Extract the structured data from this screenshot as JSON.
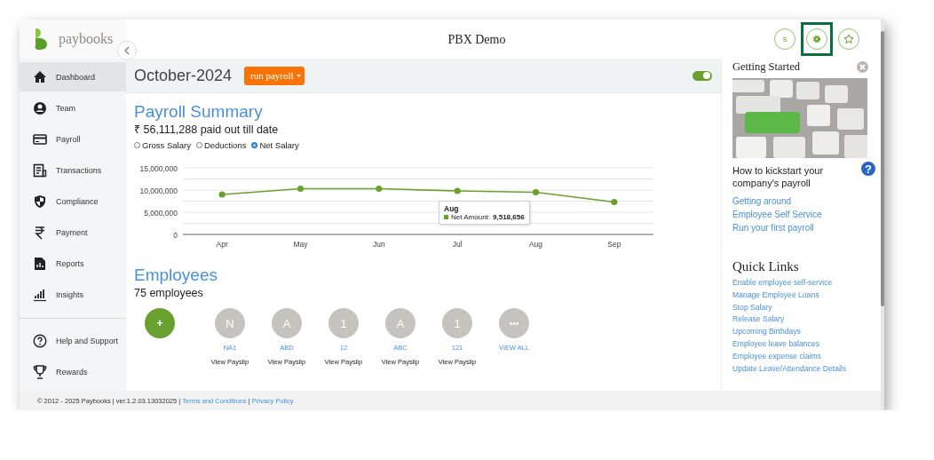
{
  "header": {
    "logo_text": "paybooks",
    "title": "PBX Demo",
    "user_initial": "s",
    "settings_highlighted": true
  },
  "sidebar": {
    "items": [
      {
        "label": "Dashboard",
        "selected": true
      },
      {
        "label": "Team",
        "selected": false
      },
      {
        "label": "Payroll",
        "selected": false
      },
      {
        "label": "Transactions",
        "selected": false
      },
      {
        "label": "Compliance",
        "selected": false
      },
      {
        "label": "Payment",
        "selected": false
      },
      {
        "label": "Reports",
        "selected": false
      },
      {
        "label": "Insights",
        "selected": false
      }
    ],
    "bottom_items": [
      {
        "label": "Help and Support",
        "selected": false
      },
      {
        "label": "Rewards",
        "selected": false
      }
    ]
  },
  "toolbar": {
    "period": "October-2024",
    "run_button": "run payroll",
    "toggle_on": true
  },
  "payroll_summary": {
    "title": "Payroll Summary",
    "total": "₹ 56,111,288 paid out till date",
    "options": [
      {
        "label": "Gross Salary",
        "selected": false
      },
      {
        "label": "Deductions",
        "selected": false
      },
      {
        "label": "Net Salary",
        "selected": true
      }
    ],
    "chart_data": {
      "type": "line",
      "categories": [
        "Apr",
        "May",
        "Jun",
        "Jul",
        "Aug",
        "Sep"
      ],
      "series": [
        {
          "name": "Net Amount",
          "color": "#6aa12e",
          "marker": "circle",
          "values": [
            9000000,
            10300000,
            10300000,
            9800000,
            9500000,
            7300000
          ]
        }
      ],
      "ylim": [
        0,
        15000000
      ],
      "yticks": [
        {
          "value": 0,
          "label": "0"
        },
        {
          "value": 5000000,
          "label": "5,000,000"
        },
        {
          "value": 10000000,
          "label": "10,000,000"
        },
        {
          "value": 15000000,
          "label": "15,000,000"
        }
      ]
    },
    "tooltip": {
      "title": "Aug",
      "separator": ":",
      "value": "9,518,656"
    }
  },
  "employees": {
    "title": "Employees",
    "count": "75 employees",
    "add_label": "+",
    "people": [
      {
        "initial": "N",
        "name": "NA1",
        "action": "View Payslip"
      },
      {
        "initial": "A",
        "name": "ABD",
        "action": "View Payslip"
      },
      {
        "initial": "1",
        "name": "12",
        "action": "View Payslip"
      },
      {
        "initial": "A",
        "name": "ABC",
        "action": "View Payslip"
      },
      {
        "initial": "1",
        "name": "121",
        "action": "View Payslip"
      }
    ],
    "view_all": {
      "initial": "•••",
      "name": "VIEW ALL"
    }
  },
  "getting_started": {
    "title": "Getting Started",
    "caption": "How to kickstart your company's payroll",
    "links": [
      "Getting around",
      "Employee Self Service",
      "Run your first payroll"
    ]
  },
  "quick_links": {
    "title": "Quick Links",
    "links": [
      "Enable employee self-service",
      "Manage Employee Loans",
      "Stop Salary",
      "Release Salary",
      "Upcoming Birthdays",
      "Employee leave balances",
      "Employee expense claims",
      "Update Leave/Attendance Details"
    ]
  },
  "footer": {
    "text": "© 2012 - 2025 Paybooks | ver.1.2.03.13032025 |",
    "links": [
      "Terms and Conditions",
      "Privacy Policy"
    ],
    "separator": "|"
  },
  "help_button": "?"
}
